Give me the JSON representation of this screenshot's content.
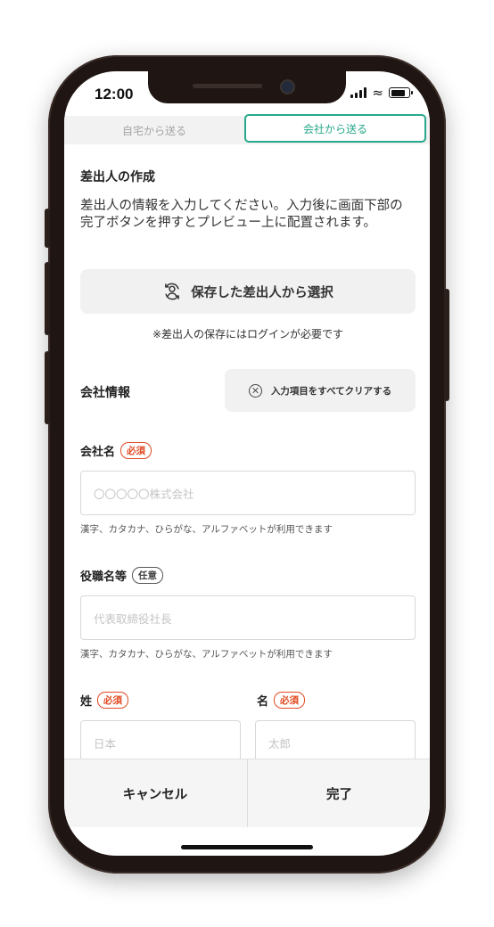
{
  "status_bar": {
    "time": "12:00"
  },
  "tabs": {
    "home_label": "自宅から送る",
    "company_label": "会社から送る"
  },
  "sender": {
    "title": "差出人の作成",
    "description": "差出人の情報を入力してください。入力後に画面下部の完了ボタンを押すとプレビュー上に配置されます。",
    "select_saved_label": "保存した差出人から選択",
    "login_note": "※差出人の保存にはログインが必要です"
  },
  "company_info": {
    "title": "会社情報",
    "clear_all_label": "入力項目をすべてクリアする",
    "company_name": {
      "label": "会社名",
      "badge": "必須",
      "placeholder": "〇〇〇〇〇株式会社",
      "hint": "漢字、カタカナ、ひらがな、アルファベットが利用できます"
    },
    "position": {
      "label": "役職名等",
      "badge": "任意",
      "placeholder": "代表取締役社長",
      "hint": "漢字、カタカナ、ひらがな、アルファベットが利用できます"
    },
    "last_name": {
      "label": "姓",
      "badge": "必須",
      "placeholder": "日本"
    },
    "first_name": {
      "label": "名",
      "badge": "必須",
      "placeholder": "太郎"
    }
  },
  "footer": {
    "cancel_label": "キャンセル",
    "done_label": "完了"
  },
  "colors": {
    "accent": "#27a88a",
    "required": "#e04a22",
    "phone_frame": "#1f1512"
  },
  "icons": {
    "select_saved": "person-sync-icon",
    "clear": "circle-x-icon"
  }
}
